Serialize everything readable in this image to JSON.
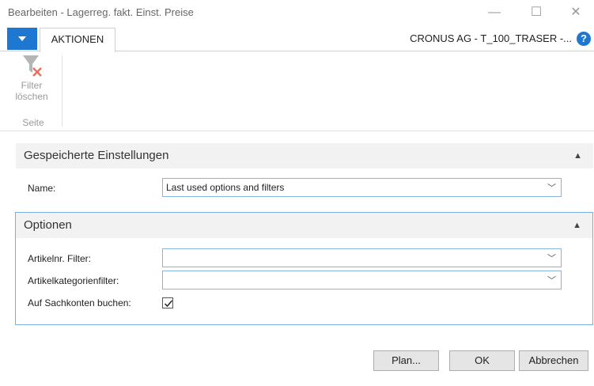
{
  "window": {
    "title": "Bearbeiten - Lagerreg. fakt. Einst. Preise",
    "minimize": "—",
    "maximize": "☐",
    "close": "✕"
  },
  "ribbon": {
    "tab_label": "AKTIONEN",
    "company": "CRONUS AG - T_100_TRASER -...",
    "help": "?",
    "clear_filter_line1": "Filter",
    "clear_filter_line2": "löschen",
    "group_label": "Seite"
  },
  "saved_settings": {
    "title": "Gespeicherte Einstellungen",
    "name_label": "Name:",
    "name_value": "Last used options and filters"
  },
  "options": {
    "title": "Optionen",
    "item_filter_label": "Artikelnr. Filter:",
    "item_filter_value": "",
    "category_filter_label": "Artikelkategorienfilter:",
    "category_filter_value": "",
    "post_gl_label": "Auf Sachkonten buchen:",
    "post_gl_checked": true
  },
  "footer": {
    "plan": "Plan...",
    "ok": "OK",
    "cancel": "Abbrechen"
  },
  "colors": {
    "accent": "#1e78d2",
    "field_border": "#8ab4e0"
  }
}
